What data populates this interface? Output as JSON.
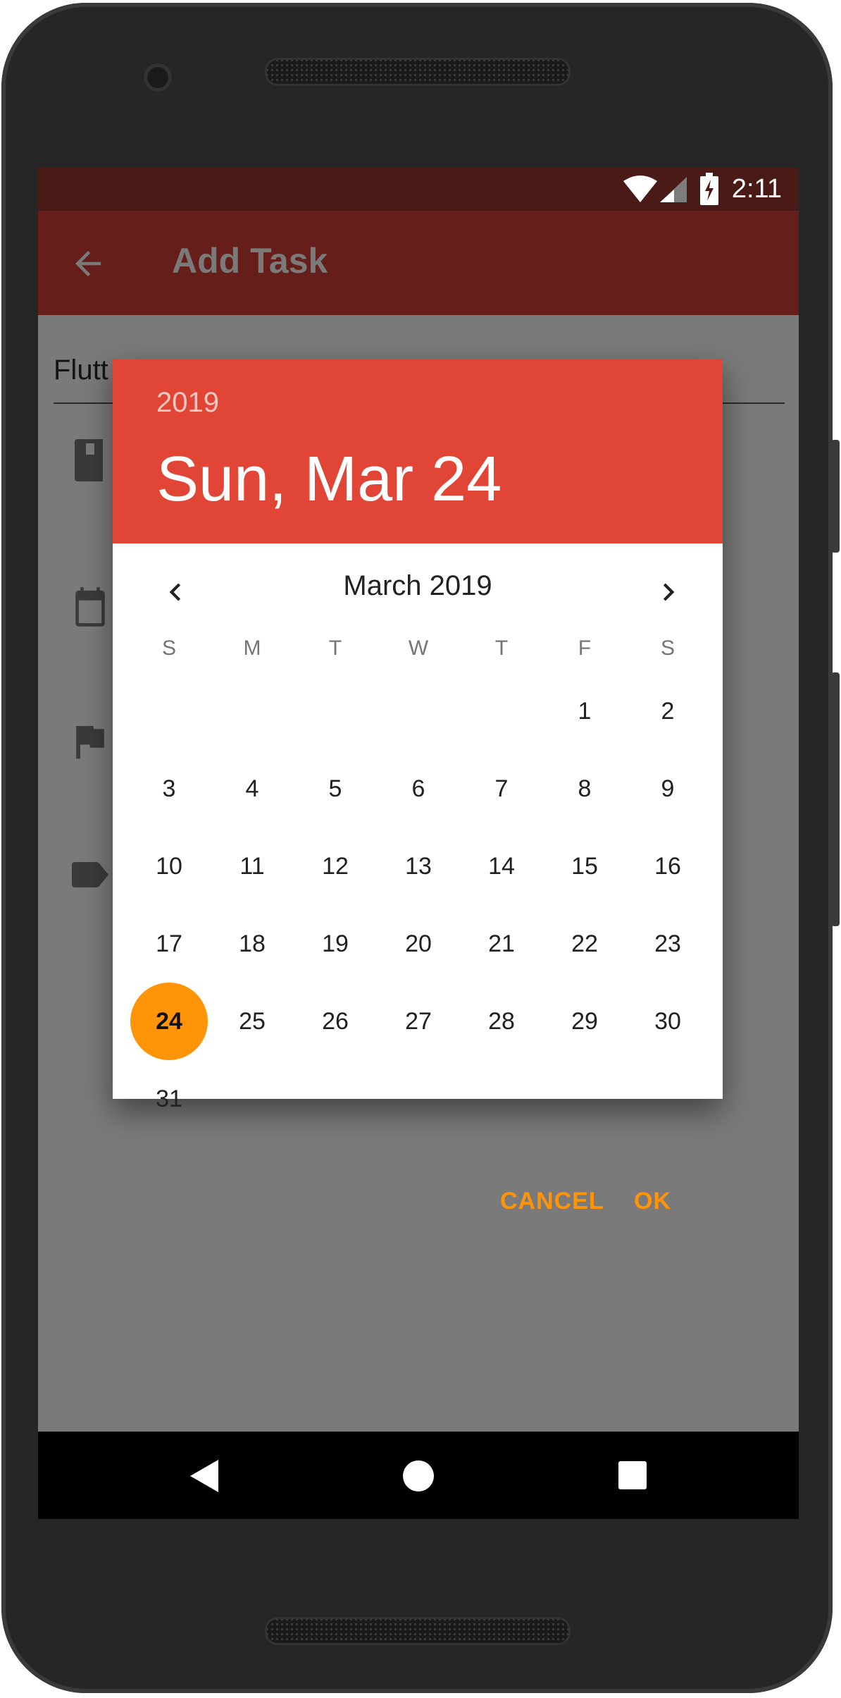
{
  "status_bar": {
    "time": "2:11"
  },
  "app_bar": {
    "title": "Add Task"
  },
  "form": {
    "task_input_value": "Flutt"
  },
  "date_picker": {
    "header_year": "2019",
    "header_date": "Sun, Mar 24",
    "month_label": "March 2019",
    "weekdays": [
      "S",
      "M",
      "T",
      "W",
      "T",
      "F",
      "S"
    ],
    "days": [
      "1",
      "2",
      "3",
      "4",
      "5",
      "6",
      "7",
      "8",
      "9",
      "10",
      "11",
      "12",
      "13",
      "14",
      "15",
      "16",
      "17",
      "18",
      "19",
      "20",
      "21",
      "22",
      "23",
      "24",
      "25",
      "26",
      "27",
      "28",
      "29",
      "30",
      "31"
    ],
    "selected_day": "24",
    "cancel_label": "CANCEL",
    "ok_label": "OK"
  },
  "colors": {
    "header": "#e04536",
    "accent": "#ff9409",
    "app_bar": "#661e1a",
    "status_bar": "#491a16"
  },
  "icons": {
    "back": "arrow-back-icon",
    "book": "book-icon",
    "calendar": "calendar-icon",
    "flag": "flag-icon",
    "label": "label-icon",
    "send": "send-icon",
    "wifi": "wifi-icon",
    "signal": "signal-icon",
    "battery": "battery-charging-icon"
  }
}
